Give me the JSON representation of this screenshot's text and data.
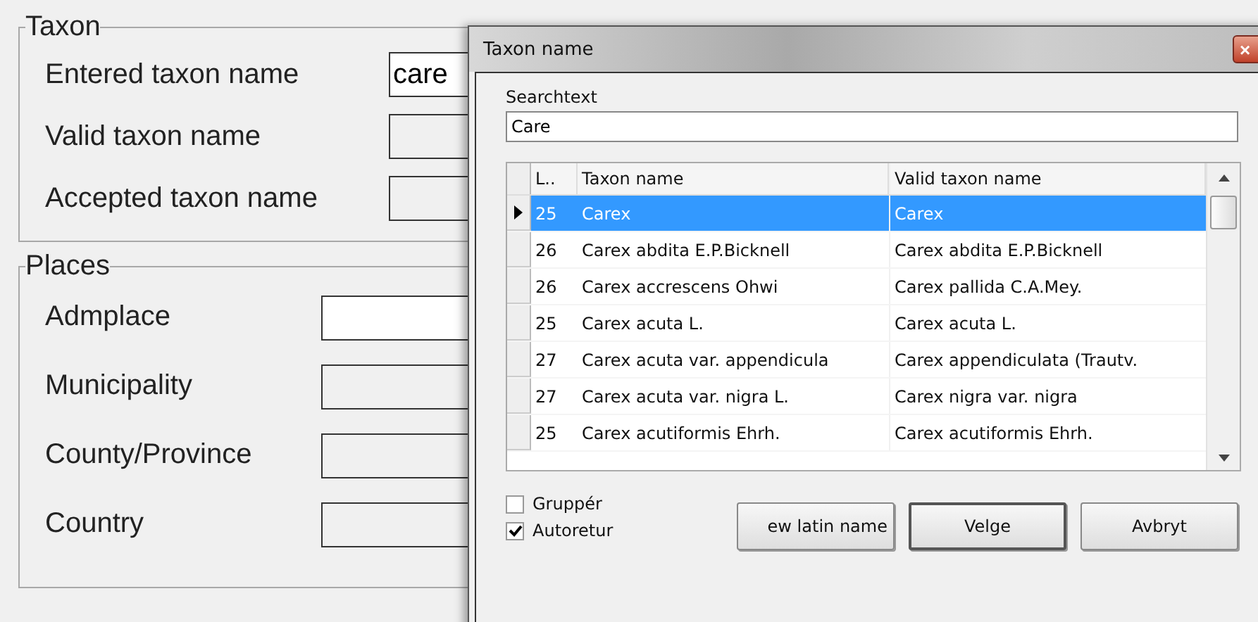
{
  "form": {
    "groups": [
      {
        "title": "Taxon",
        "fields": [
          {
            "label": "Entered taxon name",
            "value": "care"
          },
          {
            "label": "Valid taxon name"
          },
          {
            "label": "Accepted taxon name"
          }
        ]
      },
      {
        "title": "Places",
        "fields": [
          {
            "label": "Admplace"
          },
          {
            "label": "Municipality"
          },
          {
            "label": "County/Province"
          },
          {
            "label": "Country"
          }
        ]
      }
    ]
  },
  "dialog": {
    "title": "Taxon name",
    "close": "×",
    "search": {
      "label": "Searchtext",
      "value": "Care"
    },
    "table": {
      "columns": [
        "L..",
        "Taxon name",
        "Valid taxon name"
      ],
      "rows": [
        {
          "cells": [
            "25",
            "Carex",
            "Carex"
          ],
          "selected": true
        },
        {
          "cells": [
            "26",
            "Carex abdita E.P.Bicknell",
            "Carex abdita E.P.Bicknell"
          ],
          "selected": false
        },
        {
          "cells": [
            "26",
            "Carex accrescens Ohwi",
            "Carex pallida C.A.Mey."
          ],
          "selected": false
        },
        {
          "cells": [
            "25",
            "Carex acuta L.",
            "Carex acuta L."
          ],
          "selected": false
        },
        {
          "cells": [
            "27",
            "Carex acuta var. appendicula",
            "Carex appendiculata (Trautv."
          ],
          "selected": false
        },
        {
          "cells": [
            "27",
            "Carex acuta var. nigra L.",
            "Carex nigra var. nigra"
          ],
          "selected": false
        },
        {
          "cells": [
            "25",
            "Carex acutiformis Ehrh.",
            "Carex acutiformis Ehrh."
          ],
          "selected": false
        }
      ]
    },
    "checkboxes": [
      {
        "label": "Gruppér",
        "checked": false
      },
      {
        "label": "Autoretur",
        "checked": true
      }
    ],
    "buttons": [
      {
        "label": "ew latin name",
        "default": false
      },
      {
        "label": "Velge",
        "default": true
      },
      {
        "label": "Avbryt",
        "default": false
      }
    ]
  }
}
